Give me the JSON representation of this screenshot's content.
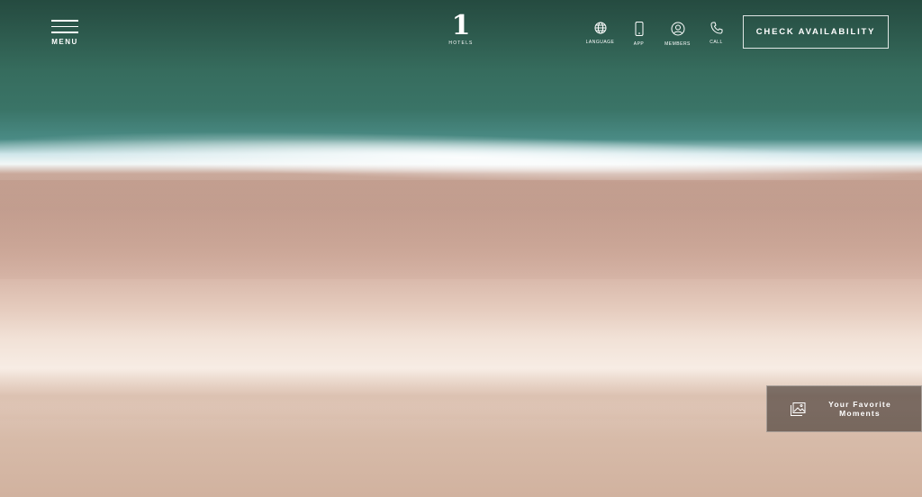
{
  "header": {
    "menu_label": "MENU",
    "logo_mark": "1",
    "logo_sub": "HOTELS",
    "utility_nav": [
      {
        "label": "LANGUAGE",
        "icon": "globe-icon"
      },
      {
        "label": "APP",
        "icon": "mobile-phone-icon"
      },
      {
        "label": "MEMBERS",
        "icon": "user-icon"
      },
      {
        "label": "CALL",
        "icon": "phone-icon"
      }
    ],
    "cta_label": "CHECK AVAILABILITY"
  },
  "floating_widget": {
    "label": "Your Favorite Moments",
    "icon": "gallery-icon"
  },
  "colors": {
    "ocean": "#356a5b",
    "sand": "#e5cbbd",
    "text": "#ffffff"
  }
}
